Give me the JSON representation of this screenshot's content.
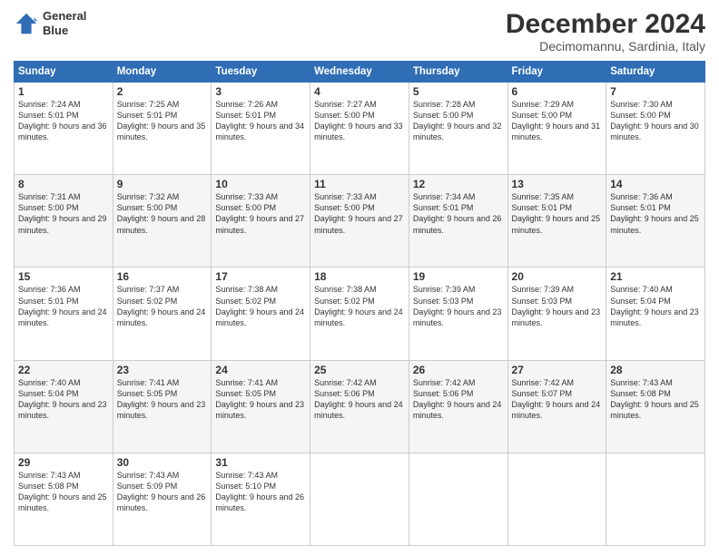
{
  "header": {
    "title": "December 2024",
    "subtitle": "Decimomannu, Sardinia, Italy",
    "logo_line1": "General",
    "logo_line2": "Blue"
  },
  "weekdays": [
    "Sunday",
    "Monday",
    "Tuesday",
    "Wednesday",
    "Thursday",
    "Friday",
    "Saturday"
  ],
  "weeks": [
    [
      {
        "day": "1",
        "sunrise": "Sunrise: 7:24 AM",
        "sunset": "Sunset: 5:01 PM",
        "daylight": "Daylight: 9 hours and 36 minutes."
      },
      {
        "day": "2",
        "sunrise": "Sunrise: 7:25 AM",
        "sunset": "Sunset: 5:01 PM",
        "daylight": "Daylight: 9 hours and 35 minutes."
      },
      {
        "day": "3",
        "sunrise": "Sunrise: 7:26 AM",
        "sunset": "Sunset: 5:01 PM",
        "daylight": "Daylight: 9 hours and 34 minutes."
      },
      {
        "day": "4",
        "sunrise": "Sunrise: 7:27 AM",
        "sunset": "Sunset: 5:00 PM",
        "daylight": "Daylight: 9 hours and 33 minutes."
      },
      {
        "day": "5",
        "sunrise": "Sunrise: 7:28 AM",
        "sunset": "Sunset: 5:00 PM",
        "daylight": "Daylight: 9 hours and 32 minutes."
      },
      {
        "day": "6",
        "sunrise": "Sunrise: 7:29 AM",
        "sunset": "Sunset: 5:00 PM",
        "daylight": "Daylight: 9 hours and 31 minutes."
      },
      {
        "day": "7",
        "sunrise": "Sunrise: 7:30 AM",
        "sunset": "Sunset: 5:00 PM",
        "daylight": "Daylight: 9 hours and 30 minutes."
      }
    ],
    [
      {
        "day": "8",
        "sunrise": "Sunrise: 7:31 AM",
        "sunset": "Sunset: 5:00 PM",
        "daylight": "Daylight: 9 hours and 29 minutes."
      },
      {
        "day": "9",
        "sunrise": "Sunrise: 7:32 AM",
        "sunset": "Sunset: 5:00 PM",
        "daylight": "Daylight: 9 hours and 28 minutes."
      },
      {
        "day": "10",
        "sunrise": "Sunrise: 7:33 AM",
        "sunset": "Sunset: 5:00 PM",
        "daylight": "Daylight: 9 hours and 27 minutes."
      },
      {
        "day": "11",
        "sunrise": "Sunrise: 7:33 AM",
        "sunset": "Sunset: 5:00 PM",
        "daylight": "Daylight: 9 hours and 27 minutes."
      },
      {
        "day": "12",
        "sunrise": "Sunrise: 7:34 AM",
        "sunset": "Sunset: 5:01 PM",
        "daylight": "Daylight: 9 hours and 26 minutes."
      },
      {
        "day": "13",
        "sunrise": "Sunrise: 7:35 AM",
        "sunset": "Sunset: 5:01 PM",
        "daylight": "Daylight: 9 hours and 25 minutes."
      },
      {
        "day": "14",
        "sunrise": "Sunrise: 7:36 AM",
        "sunset": "Sunset: 5:01 PM",
        "daylight": "Daylight: 9 hours and 25 minutes."
      }
    ],
    [
      {
        "day": "15",
        "sunrise": "Sunrise: 7:36 AM",
        "sunset": "Sunset: 5:01 PM",
        "daylight": "Daylight: 9 hours and 24 minutes."
      },
      {
        "day": "16",
        "sunrise": "Sunrise: 7:37 AM",
        "sunset": "Sunset: 5:02 PM",
        "daylight": "Daylight: 9 hours and 24 minutes."
      },
      {
        "day": "17",
        "sunrise": "Sunrise: 7:38 AM",
        "sunset": "Sunset: 5:02 PM",
        "daylight": "Daylight: 9 hours and 24 minutes."
      },
      {
        "day": "18",
        "sunrise": "Sunrise: 7:38 AM",
        "sunset": "Sunset: 5:02 PM",
        "daylight": "Daylight: 9 hours and 24 minutes."
      },
      {
        "day": "19",
        "sunrise": "Sunrise: 7:39 AM",
        "sunset": "Sunset: 5:03 PM",
        "daylight": "Daylight: 9 hours and 23 minutes."
      },
      {
        "day": "20",
        "sunrise": "Sunrise: 7:39 AM",
        "sunset": "Sunset: 5:03 PM",
        "daylight": "Daylight: 9 hours and 23 minutes."
      },
      {
        "day": "21",
        "sunrise": "Sunrise: 7:40 AM",
        "sunset": "Sunset: 5:04 PM",
        "daylight": "Daylight: 9 hours and 23 minutes."
      }
    ],
    [
      {
        "day": "22",
        "sunrise": "Sunrise: 7:40 AM",
        "sunset": "Sunset: 5:04 PM",
        "daylight": "Daylight: 9 hours and 23 minutes."
      },
      {
        "day": "23",
        "sunrise": "Sunrise: 7:41 AM",
        "sunset": "Sunset: 5:05 PM",
        "daylight": "Daylight: 9 hours and 23 minutes."
      },
      {
        "day": "24",
        "sunrise": "Sunrise: 7:41 AM",
        "sunset": "Sunset: 5:05 PM",
        "daylight": "Daylight: 9 hours and 23 minutes."
      },
      {
        "day": "25",
        "sunrise": "Sunrise: 7:42 AM",
        "sunset": "Sunset: 5:06 PM",
        "daylight": "Daylight: 9 hours and 24 minutes."
      },
      {
        "day": "26",
        "sunrise": "Sunrise: 7:42 AM",
        "sunset": "Sunset: 5:06 PM",
        "daylight": "Daylight: 9 hours and 24 minutes."
      },
      {
        "day": "27",
        "sunrise": "Sunrise: 7:42 AM",
        "sunset": "Sunset: 5:07 PM",
        "daylight": "Daylight: 9 hours and 24 minutes."
      },
      {
        "day": "28",
        "sunrise": "Sunrise: 7:43 AM",
        "sunset": "Sunset: 5:08 PM",
        "daylight": "Daylight: 9 hours and 25 minutes."
      }
    ],
    [
      {
        "day": "29",
        "sunrise": "Sunrise: 7:43 AM",
        "sunset": "Sunset: 5:08 PM",
        "daylight": "Daylight: 9 hours and 25 minutes."
      },
      {
        "day": "30",
        "sunrise": "Sunrise: 7:43 AM",
        "sunset": "Sunset: 5:09 PM",
        "daylight": "Daylight: 9 hours and 26 minutes."
      },
      {
        "day": "31",
        "sunrise": "Sunrise: 7:43 AM",
        "sunset": "Sunset: 5:10 PM",
        "daylight": "Daylight: 9 hours and 26 minutes."
      },
      {
        "day": "",
        "sunrise": "",
        "sunset": "",
        "daylight": ""
      },
      {
        "day": "",
        "sunrise": "",
        "sunset": "",
        "daylight": ""
      },
      {
        "day": "",
        "sunrise": "",
        "sunset": "",
        "daylight": ""
      },
      {
        "day": "",
        "sunrise": "",
        "sunset": "",
        "daylight": ""
      }
    ]
  ]
}
